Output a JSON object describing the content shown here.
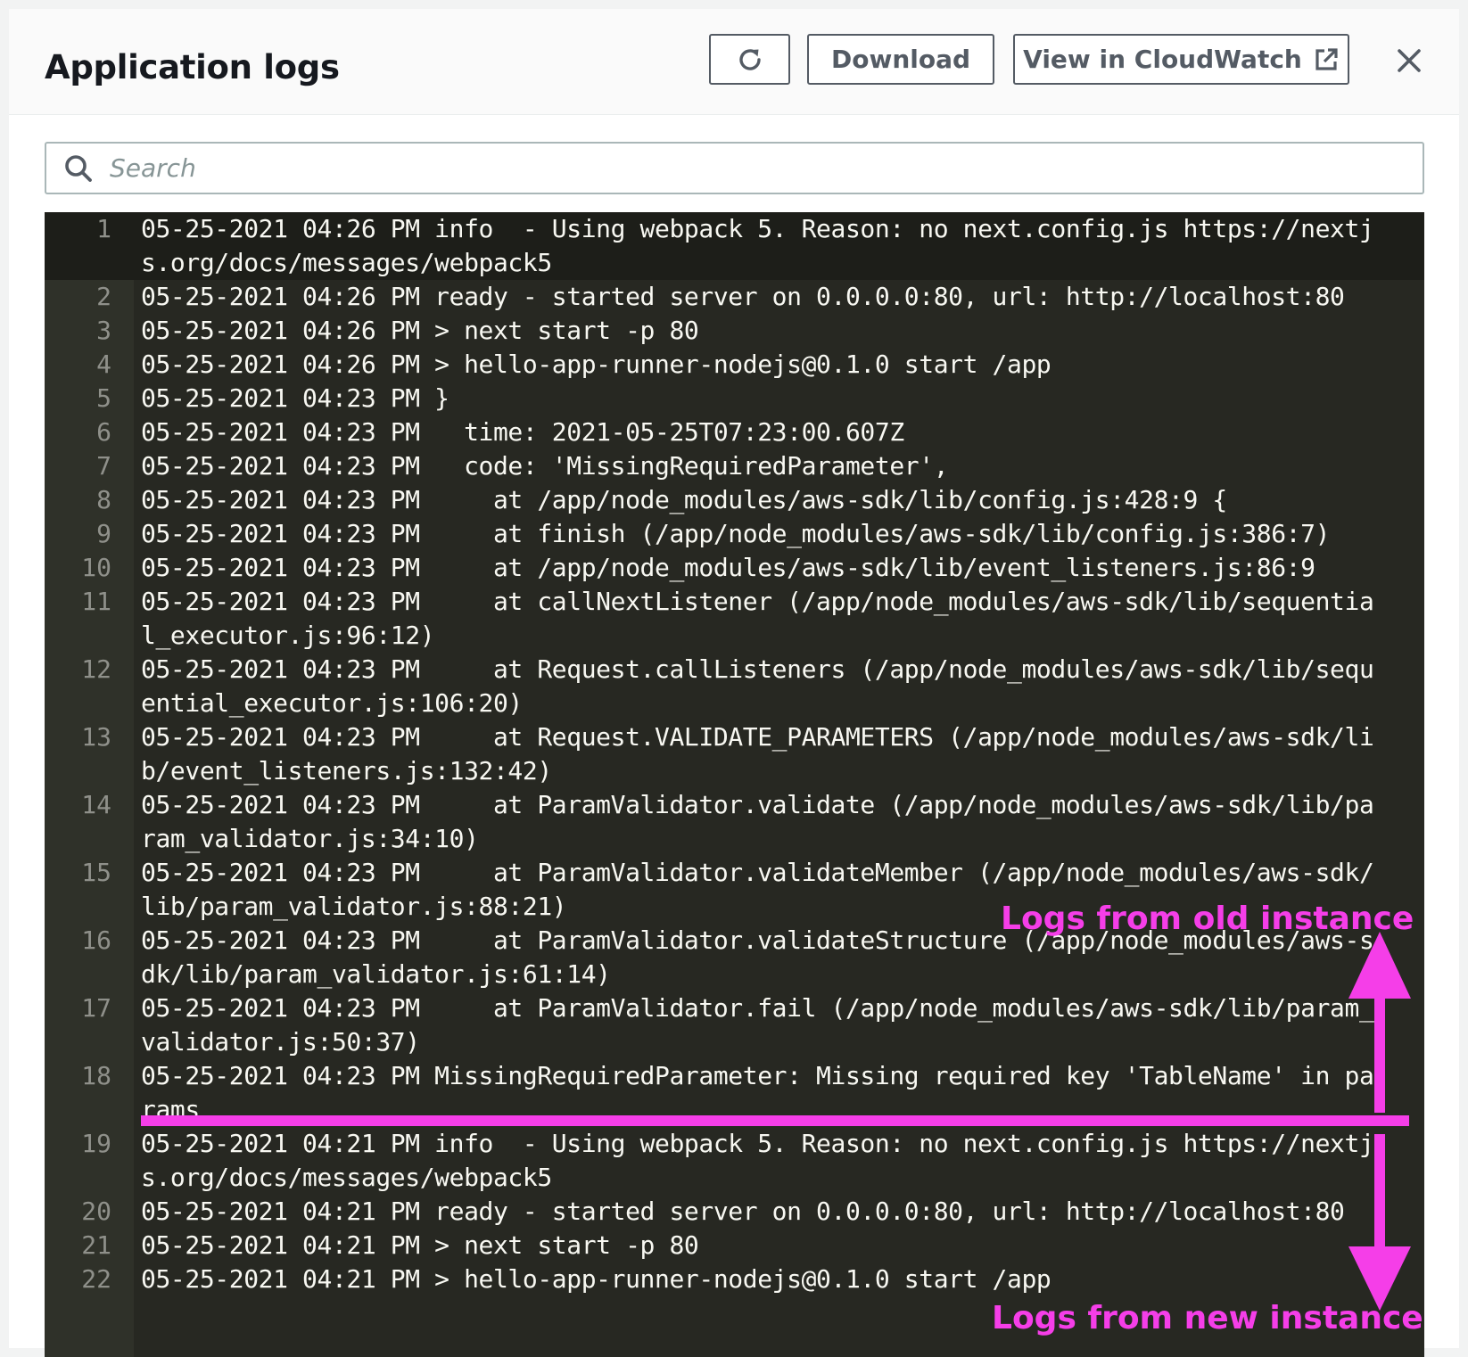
{
  "panel": {
    "title": "Application logs",
    "refresh_icon": "refresh-icon",
    "download_label": "Download",
    "cloudwatch_label": "View in CloudWatch",
    "external_link_icon": "external-link-icon",
    "close_icon": "close-icon"
  },
  "search": {
    "placeholder": "Search",
    "value": "",
    "icon": "search-icon"
  },
  "logs": [
    {
      "n": "1",
      "text": "05-25-2021 04:26 PM info  - Using webpack 5. Reason: no next.config.js https://nextjs.org/docs/messages/webpack5"
    },
    {
      "n": "2",
      "text": "05-25-2021 04:26 PM ready - started server on 0.0.0.0:80, url: http://localhost:80"
    },
    {
      "n": "3",
      "text": "05-25-2021 04:26 PM > next start -p 80"
    },
    {
      "n": "4",
      "text": "05-25-2021 04:26 PM > hello-app-runner-nodejs@0.1.0 start /app"
    },
    {
      "n": "5",
      "text": "05-25-2021 04:23 PM }"
    },
    {
      "n": "6",
      "text": "05-25-2021 04:23 PM   time: 2021-05-25T07:23:00.607Z"
    },
    {
      "n": "7",
      "text": "05-25-2021 04:23 PM   code: 'MissingRequiredParameter',"
    },
    {
      "n": "8",
      "text": "05-25-2021 04:23 PM     at /app/node_modules/aws-sdk/lib/config.js:428:9 {"
    },
    {
      "n": "9",
      "text": "05-25-2021 04:23 PM     at finish (/app/node_modules/aws-sdk/lib/config.js:386:7)"
    },
    {
      "n": "10",
      "text": "05-25-2021 04:23 PM     at /app/node_modules/aws-sdk/lib/event_listeners.js:86:9"
    },
    {
      "n": "11",
      "text": "05-25-2021 04:23 PM     at callNextListener (/app/node_modules/aws-sdk/lib/sequential_executor.js:96:12)"
    },
    {
      "n": "12",
      "text": "05-25-2021 04:23 PM     at Request.callListeners (/app/node_modules/aws-sdk/lib/sequential_executor.js:106:20)"
    },
    {
      "n": "13",
      "text": "05-25-2021 04:23 PM     at Request.VALIDATE_PARAMETERS (/app/node_modules/aws-sdk/lib/event_listeners.js:132:42)"
    },
    {
      "n": "14",
      "text": "05-25-2021 04:23 PM     at ParamValidator.validate (/app/node_modules/aws-sdk/lib/param_validator.js:34:10)"
    },
    {
      "n": "15",
      "text": "05-25-2021 04:23 PM     at ParamValidator.validateMember (/app/node_modules/aws-sdk/lib/param_validator.js:88:21)"
    },
    {
      "n": "16",
      "text": "05-25-2021 04:23 PM     at ParamValidator.validateStructure (/app/node_modules/aws-sdk/lib/param_validator.js:61:14)"
    },
    {
      "n": "17",
      "text": "05-25-2021 04:23 PM     at ParamValidator.fail (/app/node_modules/aws-sdk/lib/param_validator.js:50:37)"
    },
    {
      "n": "18",
      "text": "05-25-2021 04:23 PM MissingRequiredParameter: Missing required key 'TableName' in params"
    },
    {
      "n": "19",
      "text": "05-25-2021 04:21 PM info  - Using webpack 5. Reason: no next.config.js https://nextjs.org/docs/messages/webpack5"
    },
    {
      "n": "20",
      "text": "05-25-2021 04:21 PM ready - started server on 0.0.0.0:80, url: http://localhost:80"
    },
    {
      "n": "21",
      "text": "05-25-2021 04:21 PM > next start -p 80"
    },
    {
      "n": "22",
      "text": "05-25-2021 04:21 PM > hello-app-runner-nodejs@0.1.0 start /app"
    }
  ],
  "annotations": {
    "old_label": "Logs from old instance",
    "new_label": "Logs from new instance",
    "color": "#f53ee8"
  }
}
